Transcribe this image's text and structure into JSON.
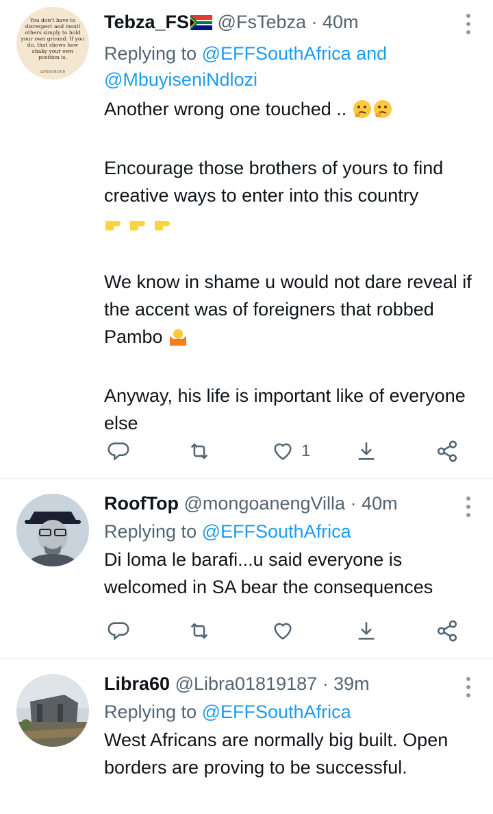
{
  "tweets": [
    {
      "display_name": "Tebza_FS",
      "handle": "@FsTebza",
      "time": "· 40m",
      "replying_prefix": "Replying to",
      "replying_to": [
        "@EFFSouthAfrica",
        "@MbuyiseniNdlozi"
      ],
      "replying_and": "and",
      "paragraphs": [
        "Another wrong one touched ..",
        "Encourage those brothers of yours to find creative ways to enter into this country",
        "We know in shame u would not dare reveal if the accent was of foreigners that robbed Pambo",
        "Anyway, his life is important like of everyone else"
      ],
      "avatar_quote": [
        "You don't have to",
        "disrespect and insult",
        "others simply to hold",
        "your own ground. If you",
        "do, that shows how",
        "shaky your own",
        "position is."
      ],
      "avatar_footer": "LIVEOUTLOUD",
      "like_count": "1",
      "icons": [
        "flag-icon",
        "thinking-face-emoji",
        "pointing-right-emoji",
        "person-shrugging-emoji"
      ]
    },
    {
      "display_name": "RoofTop",
      "handle": "@mongoanengVilla",
      "time": "· 40m",
      "replying_prefix": "Replying to",
      "replying_to": [
        "@EFFSouthAfrica"
      ],
      "paragraphs": [
        "Di loma le barafi...u said everyone is welcomed in SA bear the consequences"
      ],
      "like_count": ""
    },
    {
      "display_name": "Libra60",
      "handle": "@Libra01819187",
      "time": "· 39m",
      "replying_prefix": "Replying to",
      "replying_to": [
        "@EFFSouthAfrica"
      ],
      "paragraphs": [
        "West Africans are normally big built. Open borders are proving to be successful."
      ]
    }
  ],
  "colors": {
    "link": "#1d9bf0",
    "muted": "#536471",
    "text": "#0f1419",
    "divider": "#e6ebee"
  },
  "action_icons": [
    "reply-icon",
    "retweet-icon",
    "like-icon",
    "download-share-icon",
    "share-icon"
  ]
}
